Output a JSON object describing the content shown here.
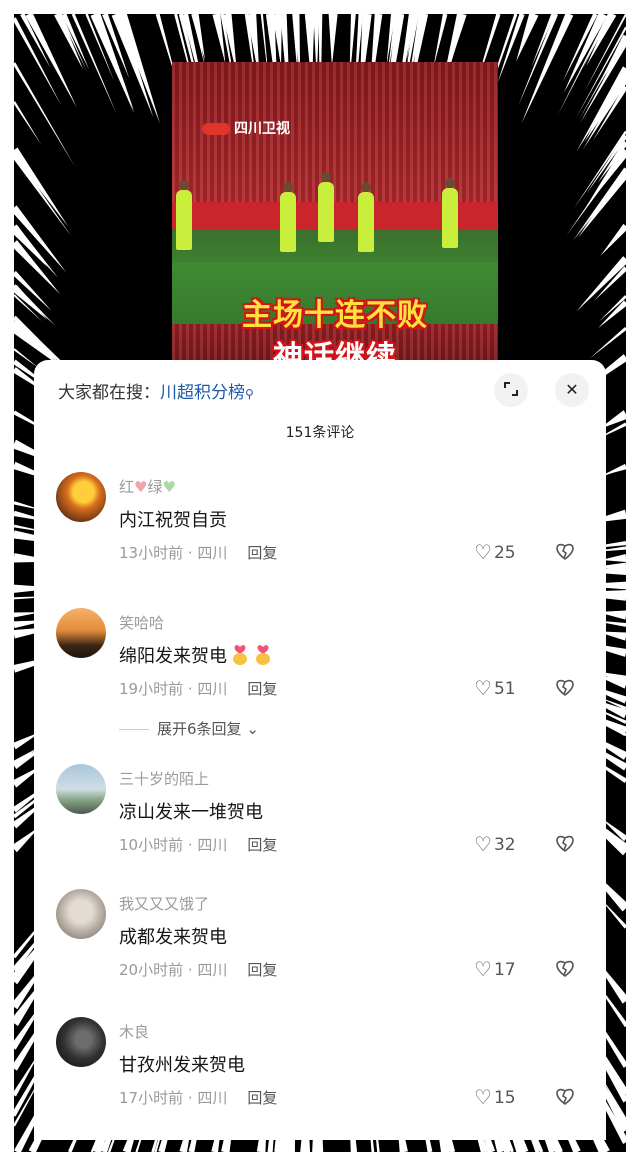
{
  "video": {
    "channel_logo": "四川卫视",
    "headline_line1": "主场十连不败",
    "headline_line2": "神话继续"
  },
  "search": {
    "prefix": "大家都在搜：",
    "keyword": "川超积分榜"
  },
  "comments_count": "151条评论",
  "comments": [
    {
      "user": "红",
      "user_suffix": "绿",
      "text": "内江祝贺自贡",
      "time": "13小时前 · 四川",
      "reply": "回复",
      "likes": "25"
    },
    {
      "user": "笑哈哈",
      "text": "绵阳发来贺电",
      "time": "19小时前 · 四川",
      "reply": "回复",
      "likes": "51",
      "expand": "展开6条回复"
    },
    {
      "user": "三十岁的陌上",
      "text": "凉山发来一堆贺电",
      "time": "10小时前 · 四川",
      "reply": "回复",
      "likes": "32"
    },
    {
      "user": "我又又又饿了",
      "text": "成都发来贺电",
      "time": "20小时前 · 四川",
      "reply": "回复",
      "likes": "17"
    },
    {
      "user": "木良",
      "text": "甘孜州发来贺电",
      "time": "17小时前 · 四川",
      "reply": "回复",
      "likes": "15"
    }
  ],
  "colors": {
    "accent": "#1e5aa8",
    "muted": "#9a9a9a",
    "video_title": "#ffe23b"
  }
}
